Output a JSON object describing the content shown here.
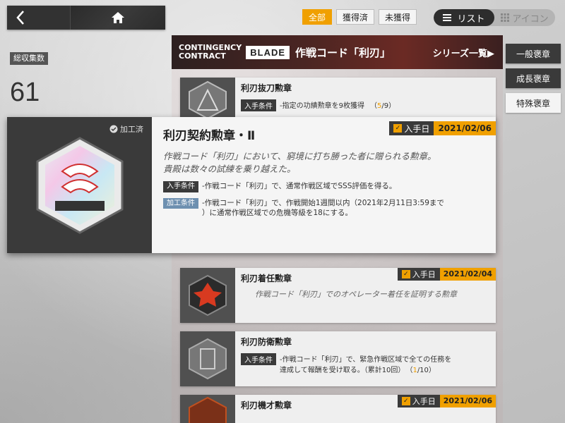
{
  "nav": {
    "back_icon": "chevron-left-icon",
    "home_icon": "home-icon"
  },
  "filters": [
    {
      "label": "全部",
      "active": true
    },
    {
      "label": "獲得済",
      "active": false
    },
    {
      "label": "未獲得",
      "active": false
    }
  ],
  "view_toggle": {
    "list_label": "リスト",
    "icon_label": "アイコン"
  },
  "banner": {
    "contract_line1": "CONTINGENCY",
    "contract_line2": "CONTRACT",
    "blade": "BLADE",
    "code": "作戦コード「利刃」",
    "series_link": "シリーズ一覧▶"
  },
  "stats": {
    "total_label": "総収集数",
    "total_count": "61"
  },
  "category_tabs": [
    {
      "label": "一般褒章",
      "active": false
    },
    {
      "label": "成長褒章",
      "active": false
    },
    {
      "label": "特殊褒章",
      "active": true
    }
  ],
  "detail": {
    "processed_label": "加工済",
    "title": "利刃契約勲章・Ⅱ",
    "date_label": "入手日",
    "date": "2021/02/06",
    "desc_line1": "作戦コード「利刃」において、窮境に打ち勝った者に贈られる勲章。",
    "desc_line2": "貴殿は数々の試練を乗り越えた。",
    "cond_badge": "入手条件",
    "cond_text": "-作戦コード「利刃」で、通常作戦区域でSSS評価を得る。",
    "proc_badge": "加工条件",
    "proc_text_line1": "-作戦コード「利刃」で、作戦開始1週間以内（2021年2月11日3:59まで",
    "proc_text_line2": "）に通常作戦区域での危機等級を18にする。"
  },
  "rows": [
    {
      "name": "利刃抜刀勲章",
      "cond_badge": "入手条件",
      "cond_text": "-指定の功績勲章を9枚獲得",
      "progress_open": "（",
      "progress_cur": "5",
      "progress_rest": "/9）"
    },
    {
      "name": "利刃着任勲章",
      "date_label": "入手日",
      "date": "2021/02/04",
      "quote": "作戦コード「利刃」でのオペレーター着任を証明する勲章"
    },
    {
      "name": "利刃防衛勲章",
      "cond_badge": "入手条件",
      "cond_text_line1": "-作戦コード「利刃」で、緊急作戦区域で全ての任務を",
      "cond_text_line2": "達成して報酬を受け取る。（累計10回）",
      "progress_open": "（",
      "progress_cur": "1",
      "progress_rest": "/10）"
    },
    {
      "name": "利刃機才勲章",
      "date_label": "入手日",
      "date": "2021/02/06"
    }
  ]
}
